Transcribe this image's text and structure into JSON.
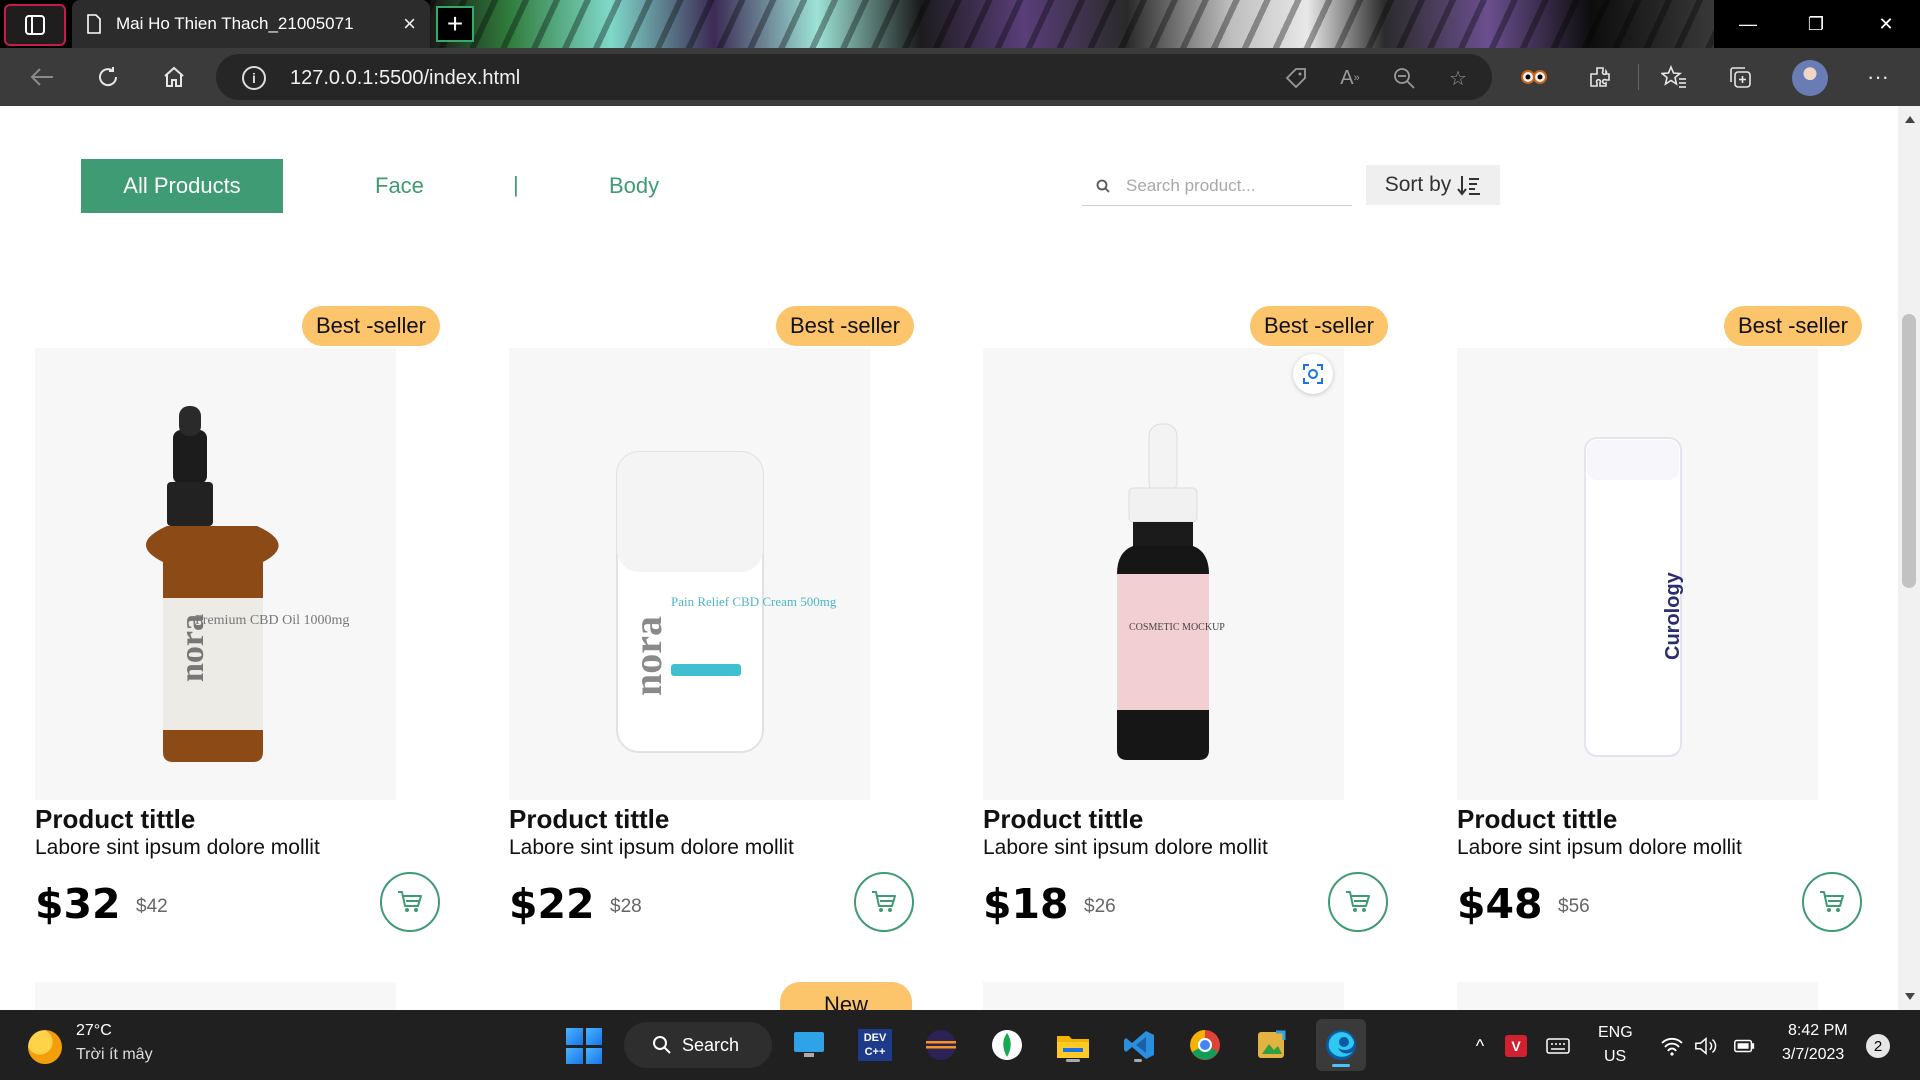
{
  "browser": {
    "tab_title": "Mai Ho Thien Thach_21005071",
    "tab_close": "×",
    "new_tab": "+",
    "url": "127.0.0.1:5500/index.html",
    "window_controls": {
      "minimize": "—",
      "restore": "❐",
      "close": "✕"
    },
    "nav": {
      "back": "back-arrow-icon",
      "refresh": "refresh-icon",
      "home": "home-icon"
    },
    "omnibox_icons": [
      "info-icon",
      "tag-icon",
      "read-aloud-icon",
      "zoom-icon",
      "add-favorite-icon"
    ],
    "toolbar_icons": [
      "extension-eyes-icon",
      "extensions-icon",
      "favorites-icon",
      "collections-icon",
      "profile-avatar",
      "more-icon"
    ]
  },
  "filters": {
    "all_products": "All Products",
    "face": "Face",
    "separator": "|",
    "body": "Body"
  },
  "search": {
    "placeholder": "Search product..."
  },
  "sort": {
    "label": "Sort by"
  },
  "products": [
    {
      "badge": "Best -seller",
      "image_label": "Premium CBD Oil 1000mg",
      "brand": "nora",
      "title": "Product tittle",
      "description": "Labore sint ipsum dolore mollit",
      "price": "$32",
      "old_price": "$42"
    },
    {
      "badge": "Best -seller",
      "image_label": "Pain Relief CBD Cream 500mg",
      "brand": "nora",
      "title": "Product tittle",
      "description": "Labore sint ipsum dolore mollit",
      "price": "$22",
      "old_price": "$28"
    },
    {
      "badge": "Best -seller",
      "image_label": "COSMETIC MOCKUP",
      "brand": "",
      "title": "Product tittle",
      "description": "Labore sint ipsum dolore mollit",
      "price": "$18",
      "old_price": "$26"
    },
    {
      "badge": "Best -seller",
      "image_label": "Curology",
      "brand": "",
      "title": "Product tittle",
      "description": "Labore sint ipsum dolore mollit",
      "price": "$48",
      "old_price": "$56"
    }
  ],
  "next_row": {
    "badge": "New"
  },
  "taskbar": {
    "weather_temp": "27°C",
    "weather_desc": "Trời ít mây",
    "search_label": "Search",
    "apps": [
      "desktop-app",
      "devc-app",
      "eclipse-app",
      "mongodb-app",
      "file-explorer-app",
      "vscode-app",
      "chrome-app",
      "photos-app",
      "edge-app"
    ],
    "devc_label": "DEV C++",
    "lang_top": "ENG",
    "lang_bottom": "US",
    "time": "8:42 PM",
    "date": "3/7/2023",
    "notifications": "2",
    "tray_chevron": "^"
  },
  "colors": {
    "accent": "#3f9b73",
    "badge": "#fcc46b",
    "chrome": "#3b3b3b",
    "taskbar": "#202020"
  }
}
